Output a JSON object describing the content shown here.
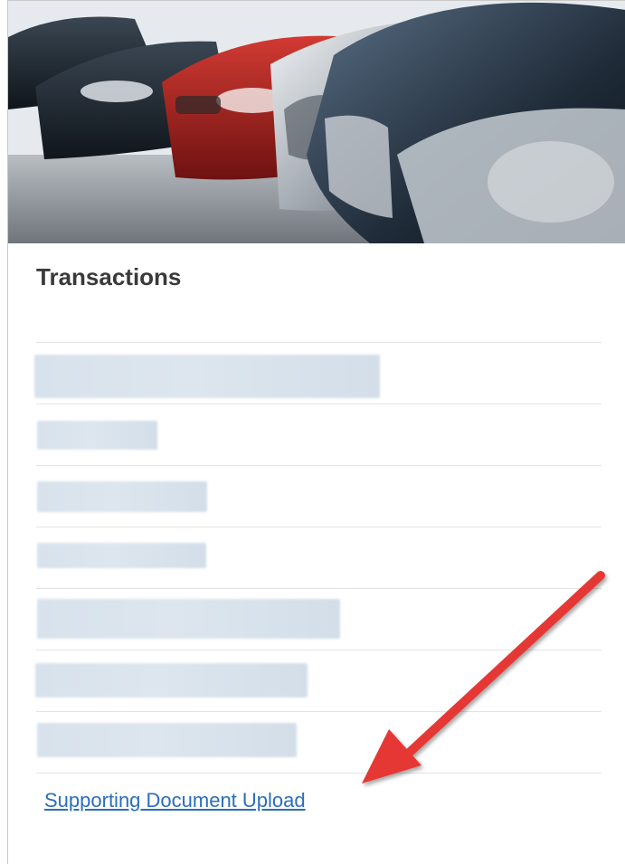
{
  "panel": {
    "title": "Transactions",
    "links": [
      {
        "label": "",
        "blurred": true
      },
      {
        "label": "",
        "blurred": true
      },
      {
        "label": "",
        "blurred": true
      },
      {
        "label": "",
        "blurred": true
      },
      {
        "label": "",
        "blurred": true
      },
      {
        "label": "",
        "blurred": true
      },
      {
        "label": "",
        "blurred": true
      }
    ],
    "upload_link": "Supporting Document Upload"
  },
  "colors": {
    "link": "#2a6ebb",
    "arrow": "#e53935",
    "title": "#3a3a3a"
  },
  "hero_image": "cars-in-parking-lot-photo",
  "annotation": "red-arrow-pointing-to-upload-link"
}
